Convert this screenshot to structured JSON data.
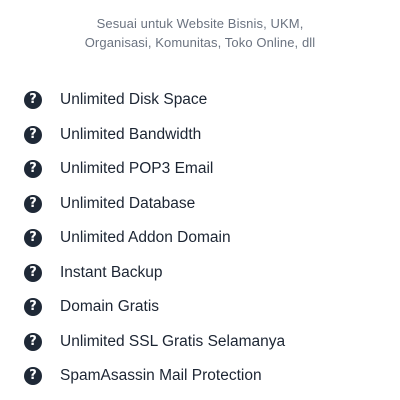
{
  "header": {
    "subtitle_line1": "Sesuai untuk Website Bisnis, UKM,",
    "subtitle_line2": "Organisasi, Komunitas, Toko Online, dll"
  },
  "features": {
    "icon": "question-circle-icon",
    "icon_glyph": "?",
    "items": [
      {
        "label": "Unlimited Disk Space"
      },
      {
        "label": "Unlimited Bandwidth"
      },
      {
        "label": "Unlimited POP3 Email"
      },
      {
        "label": "Unlimited Database"
      },
      {
        "label": "Unlimited Addon Domain"
      },
      {
        "label": "Instant Backup"
      },
      {
        "label": "Domain Gratis"
      },
      {
        "label": "Unlimited SSL Gratis Selamanya"
      },
      {
        "label": "SpamAsassin Mail Protection"
      }
    ]
  },
  "colors": {
    "icon_bg": "#1f2937",
    "subtitle_text": "#6b7380",
    "feature_text": "#1c2533"
  }
}
